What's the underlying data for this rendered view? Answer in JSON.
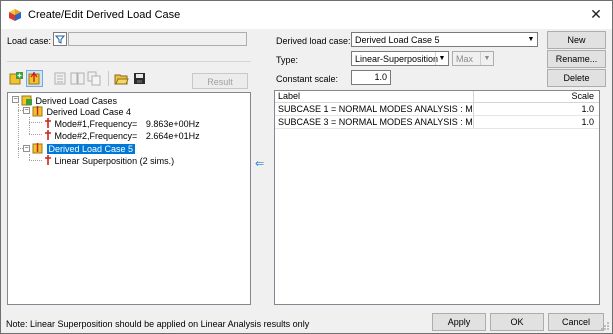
{
  "window": {
    "title": "Create/Edit Derived Load Case",
    "close_glyph": "✕"
  },
  "load_case": {
    "label": "Load case:",
    "value": ""
  },
  "toolbar": {
    "result_files_label": "Result Files..."
  },
  "tree": {
    "root": "Derived Load Cases",
    "case4": "Derived Load Case 4",
    "mode1": "Mode#1,Frequency=",
    "mode1_value": "9.863e+00Hz",
    "mode2": "Mode#2,Frequency=",
    "mode2_value": "2.664e+01Hz",
    "case5": "Derived Load Case 5",
    "linear": "Linear Superposition (2 sims.)"
  },
  "arrow_glyph": "⇐",
  "form": {
    "derived_label": "Derived load case:",
    "derived_value": "Derived Load Case 5",
    "type_label": "Type:",
    "type_value": "Linear-Superposition",
    "max_value": "Max",
    "scale_label": "Constant scale:",
    "scale_value": "1.0"
  },
  "buttons": {
    "new": "New",
    "rename": "Rename...",
    "delete": "Delete",
    "apply": "Apply",
    "ok": "OK",
    "cancel": "Cancel"
  },
  "table": {
    "columns": [
      "Label",
      "Scale"
    ],
    "rows": [
      {
        "label": "SUBCASE 1 = NORMAL MODES ANALYSIS  : Mode#1",
        "scale": "1.0"
      },
      {
        "label": "SUBCASE 3 = NORMAL MODES ANALYSIS  : Mode#3",
        "scale": "1.0"
      }
    ]
  },
  "status": "Note: Linear Superposition should be applied on Linear Analysis results only",
  "colors": {
    "selection": "#0078d7",
    "tree_icon_red": "#d0201a",
    "icon_yellow": "#f2c230"
  }
}
